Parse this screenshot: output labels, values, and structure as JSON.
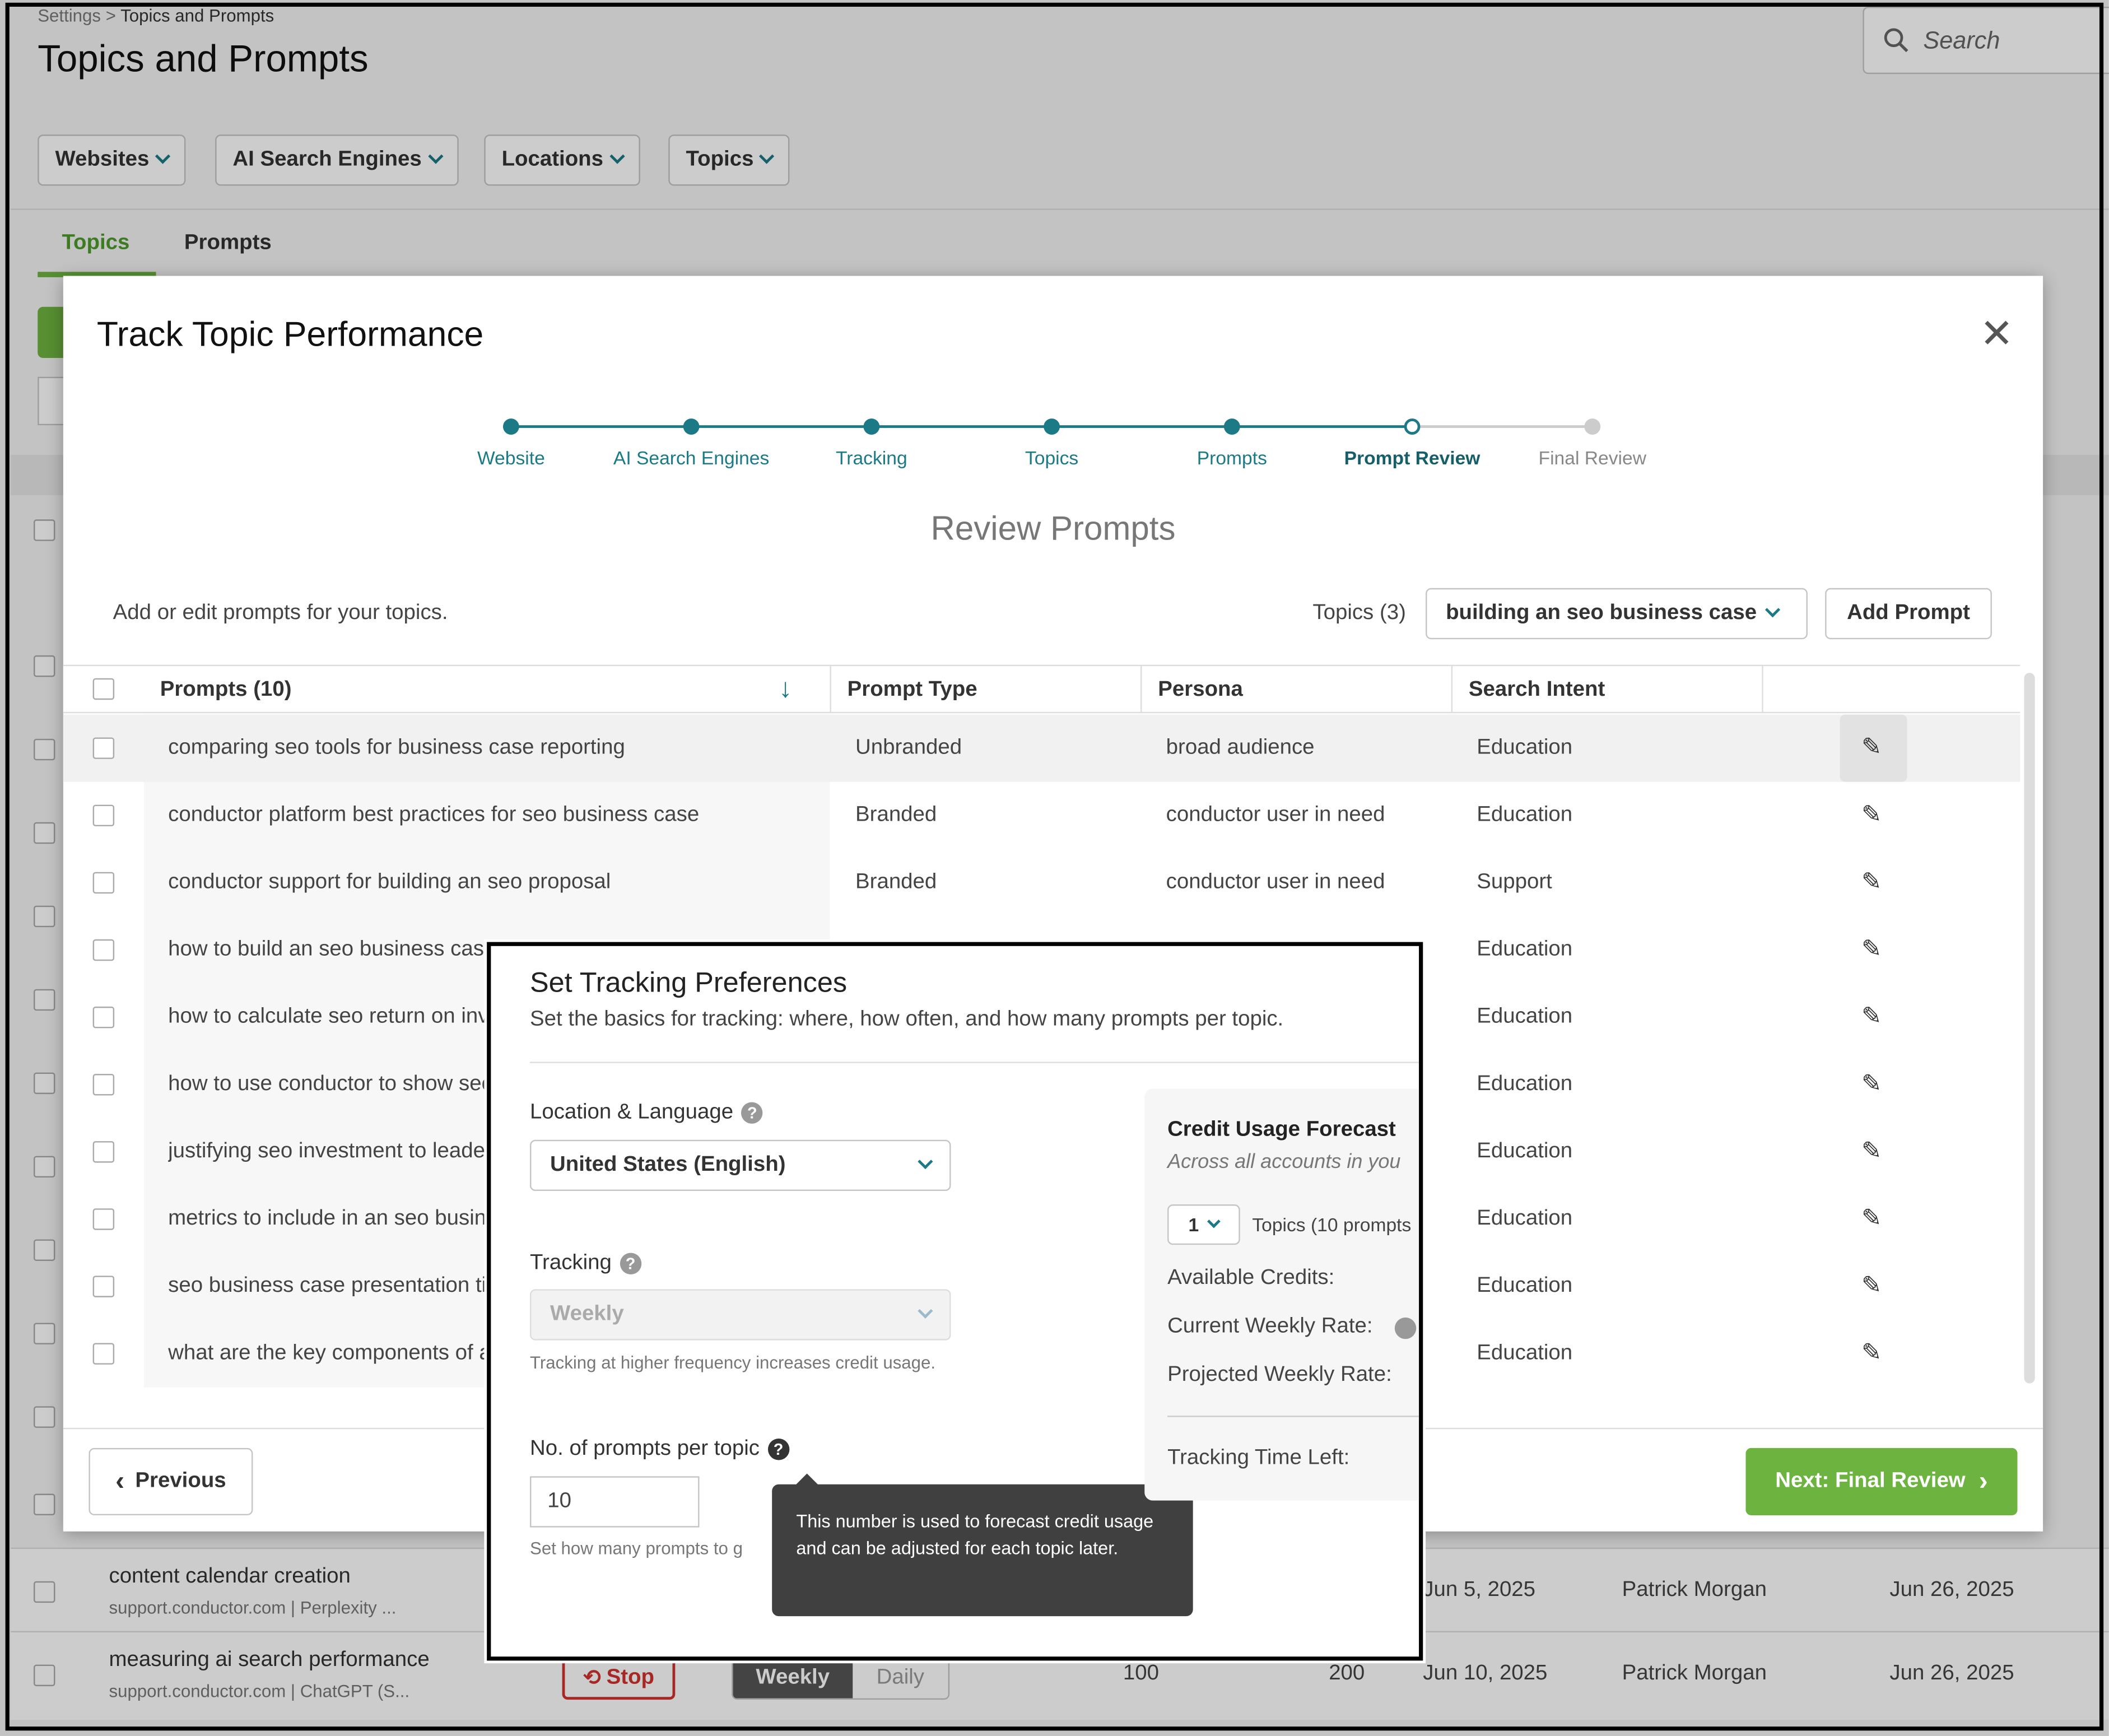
{
  "breadcrumb": {
    "root": "Settings",
    "sep": ">",
    "current": "Topics and Prompts"
  },
  "page_title": "Topics and Prompts",
  "search": {
    "placeholder": "Search"
  },
  "filters": [
    {
      "label": "Websites"
    },
    {
      "label": "AI Search Engines"
    },
    {
      "label": "Locations"
    },
    {
      "label": "Topics"
    }
  ],
  "tabs": [
    {
      "label": "Topics",
      "active": true
    },
    {
      "label": "Prompts",
      "active": false
    }
  ],
  "background_rows": [
    {
      "title": "content calendar creation",
      "meta": "support.conductor.com | Perplexity ...",
      "created": "Jun 5, 2025",
      "owner": "Patrick Morgan",
      "updated": "Jun 26, 2025"
    },
    {
      "title": "measuring ai search performance",
      "meta": "support.conductor.com | ChatGPT (S...",
      "stop_label": "Stop",
      "freq_weekly": "Weekly",
      "freq_daily": "Daily",
      "v1": "100",
      "v2": "200",
      "created": "Jun 10, 2025",
      "owner": "Patrick Morgan",
      "updated": "Jun 26, 2025"
    }
  ],
  "modal": {
    "title": "Track Topic Performance",
    "close": "✕",
    "steps": [
      {
        "label": "Website",
        "state": "done"
      },
      {
        "label": "AI Search Engines",
        "state": "done"
      },
      {
        "label": "Tracking",
        "state": "done"
      },
      {
        "label": "Topics",
        "state": "done"
      },
      {
        "label": "Prompts",
        "state": "done"
      },
      {
        "label": "Prompt Review",
        "state": "current"
      },
      {
        "label": "Final Review",
        "state": "todo"
      }
    ],
    "subtitle": "Review Prompts",
    "intro": "Add or edit prompts for your topics.",
    "topics_label": "Topics (3)",
    "topic_selected": "building an seo business case",
    "add_prompt": "Add Prompt",
    "columns": {
      "prompts": "Prompts (10)",
      "type": "Prompt Type",
      "persona": "Persona",
      "intent": "Search Intent"
    },
    "rows": [
      {
        "prompt": "comparing seo tools for business case reporting",
        "type": "Unbranded",
        "persona": "broad audience",
        "intent": "Education"
      },
      {
        "prompt": "conductor platform best practices for seo business case",
        "type": "Branded",
        "persona": "conductor user in need",
        "intent": "Education"
      },
      {
        "prompt": "conductor support for building an seo proposal",
        "type": "Branded",
        "persona": "conductor user in need",
        "intent": "Support"
      },
      {
        "prompt": "how to build an seo business case",
        "type": "",
        "persona": "",
        "intent": "Education"
      },
      {
        "prompt": "how to calculate seo return on investment",
        "type": "",
        "persona": "",
        "intent": "Education"
      },
      {
        "prompt": "how to use conductor to show seo value",
        "type": "",
        "persona": "",
        "intent": "Education"
      },
      {
        "prompt": "justifying seo investment to leadership",
        "type": "",
        "persona": "",
        "intent": "Education"
      },
      {
        "prompt": "metrics to include in an seo business case",
        "type": "",
        "persona": "",
        "intent": "Education"
      },
      {
        "prompt": "seo business case presentation tips",
        "type": "",
        "persona": "",
        "intent": "Education"
      },
      {
        "prompt": "what are the key components of an seo business case",
        "type": "",
        "persona": "",
        "intent": "Education"
      }
    ],
    "previous": "Previous",
    "next": "Next: Final Review"
  },
  "prefs": {
    "title": "Set Tracking Preferences",
    "desc": "Set the basics for tracking: where, how often, and how many prompts per topic.",
    "location_label": "Location & Language",
    "location_value": "United States (English)",
    "tracking_label": "Tracking",
    "tracking_value": "Weekly",
    "tracking_hint": "Tracking at higher frequency increases credit usage.",
    "prompts_label": "No. of prompts per topic",
    "prompts_value": "10",
    "prompts_hint": "Set how many prompts to g",
    "tooltip": "This number is used to forecast credit usage and can be adjusted for each topic later.",
    "forecast": {
      "title": "Credit Usage Forecast",
      "subtitle": "Across all accounts in you",
      "topics_count": "1",
      "topics_text": "Topics (10 prompts",
      "available": "Available Credits:",
      "current": "Current Weekly Rate:",
      "projected": "Projected Weekly Rate:",
      "time_left": "Tracking Time Left:"
    }
  },
  "colors": {
    "teal": "#1b7a86",
    "green": "#6db33f",
    "stop_red": "#d0312d"
  }
}
